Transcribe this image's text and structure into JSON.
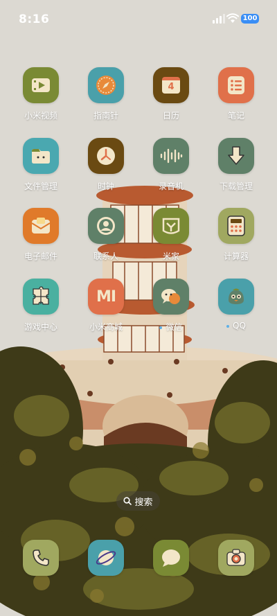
{
  "status_bar": {
    "time": "8:16",
    "battery": "100"
  },
  "apps": [
    {
      "label": "小米视频",
      "color": "#7a8a34",
      "icon": "video-icon"
    },
    {
      "label": "指南针",
      "color": "#4aa0aa",
      "icon": "compass-icon"
    },
    {
      "label": "日历",
      "color": "#6a4a12",
      "icon": "calendar-icon",
      "calendar_day": "4"
    },
    {
      "label": "笔记",
      "color": "#e0704a",
      "icon": "notes-icon"
    },
    {
      "label": "文件管理",
      "color": "#4aa8b0",
      "icon": "folder-icon"
    },
    {
      "label": "时钟",
      "color": "#6a4a12",
      "icon": "clock-icon"
    },
    {
      "label": "录音机",
      "color": "#5f8068",
      "icon": "sound-wave-icon"
    },
    {
      "label": "下载管理",
      "color": "#5f8068",
      "icon": "download-icon"
    },
    {
      "label": "电子邮件",
      "color": "#e07a2a",
      "icon": "mail-icon"
    },
    {
      "label": "联系人",
      "color": "#5f8068",
      "icon": "contact-icon"
    },
    {
      "label": "米家",
      "color": "#7a8a34",
      "icon": "mijia-icon"
    },
    {
      "label": "计算器",
      "color": "#a0a860",
      "icon": "calculator-icon"
    },
    {
      "label": "游戏中心",
      "color": "#4ab0a0",
      "icon": "puzzle-icon"
    },
    {
      "label": "小米商城",
      "color": "#e0704a",
      "icon": "mi-logo-icon",
      "logo_text": "mi"
    },
    {
      "label": "微信",
      "color": "#5f8068",
      "icon": "chat-bubble-icon",
      "dot": true
    },
    {
      "label": "QQ",
      "color": "#4aa0aa",
      "icon": "penguin-icon",
      "dot": true
    }
  ],
  "search": {
    "label": "搜索"
  },
  "dock": [
    {
      "name": "phone",
      "color": "#a0a860",
      "icon": "phone-icon"
    },
    {
      "name": "browser",
      "color": "#4aa0aa",
      "icon": "planet-icon"
    },
    {
      "name": "messages",
      "color": "#7a8a34",
      "icon": "message-icon"
    },
    {
      "name": "camera",
      "color": "#a0a860",
      "icon": "camera-icon"
    }
  ]
}
